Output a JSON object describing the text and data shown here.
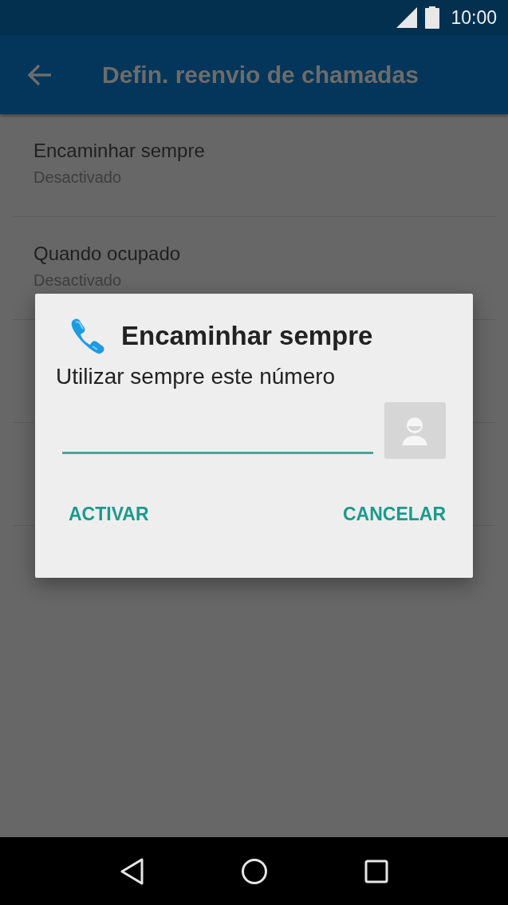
{
  "status_bar": {
    "time": "10:00"
  },
  "app_bar": {
    "title": "Defin. reenvio de chamadas"
  },
  "settings": [
    {
      "title": "Encaminhar sempre",
      "summary": "Desactivado"
    },
    {
      "title": "Quando ocupado",
      "summary": "Desactivado"
    }
  ],
  "dialog": {
    "title": "Encaminhar sempre",
    "message": "Utilizar sempre este número",
    "buttons": [
      "ACTIVAR",
      "CANCELAR"
    ]
  }
}
